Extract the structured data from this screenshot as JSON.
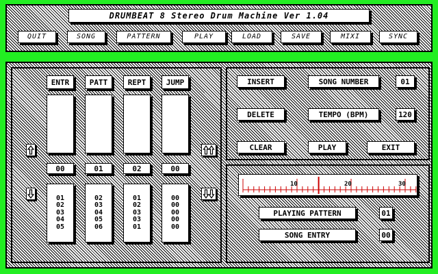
{
  "title": "DRUMBEAT 8 Stereo Drum Machine  Ver 1.04",
  "menu": [
    "QUIT",
    "SONG",
    "PATTERN",
    "PLAY",
    "LOAD",
    "SAVE",
    "MIXI",
    "SYNC"
  ],
  "columns": {
    "headers": [
      "ENTR",
      "PATT",
      "REPT",
      "JUMP"
    ],
    "current": [
      "00",
      "01",
      "02",
      "00"
    ],
    "lists": [
      [
        "01",
        "02",
        "03",
        "04",
        "05"
      ],
      [
        "02",
        "03",
        "04",
        "05",
        "06"
      ],
      [
        "01",
        "02",
        "03",
        "03",
        "01"
      ],
      [
        "00",
        "00",
        "00",
        "00",
        "00"
      ]
    ]
  },
  "controls": {
    "insert": "INSERT",
    "song_number_label": "SONG NUMBER",
    "song_number_value": "01",
    "delete": "DELETE",
    "tempo_label": "TEMPO (BPM)",
    "tempo_value": "120",
    "clear": "CLEAR",
    "play": "PLAY",
    "exit": "EXIT"
  },
  "ruler": {
    "labels": [
      "10",
      "20",
      "30"
    ],
    "position": 14
  },
  "status": {
    "playing_pattern_label": "PLAYING PATTERN",
    "playing_pattern_value": "01",
    "song_entry_label": "SONG ENTRY",
    "song_entry_value": "00"
  },
  "colors": {
    "background": "#22ee22",
    "panel": "#ffffff",
    "ruler_ticks": "#cc0000"
  },
  "icons": [
    "up-arrow-icon",
    "down-arrow-icon",
    "double-up-arrow-icon",
    "double-down-arrow-icon"
  ]
}
